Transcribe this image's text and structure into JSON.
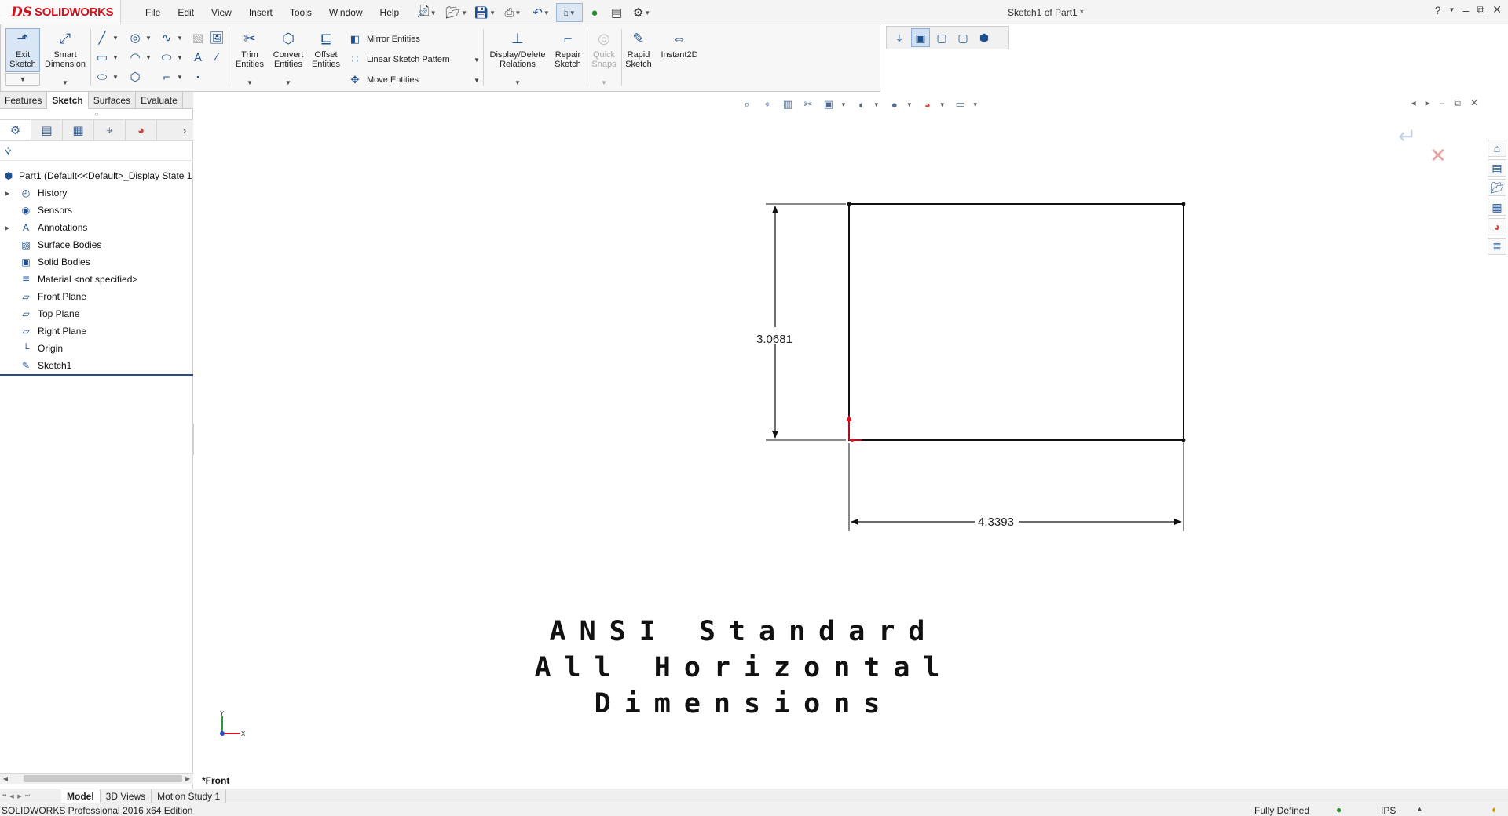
{
  "app": {
    "brand": "SOLIDWORKS",
    "brand_mark": "DS",
    "document_title": "Sketch1 of Part1 *"
  },
  "menu": [
    "File",
    "Edit",
    "View",
    "Insert",
    "Tools",
    "Window",
    "Help"
  ],
  "window_controls": {
    "help": "?",
    "minimize": "–",
    "restore": "⧉",
    "close": "✕"
  },
  "command_manager": {
    "exit_sketch": "Exit Sketch",
    "smart_dimension": "Smart Dimension",
    "trim_entities": "Trim Entities",
    "convert_entities": "Convert Entities",
    "offset_entities": "Offset Entities",
    "mirror_entities": "Mirror Entities",
    "linear_sketch_pattern": "Linear Sketch Pattern",
    "move_entities": "Move Entities",
    "display_delete_relations": "Display/Delete Relations",
    "repair_sketch": "Repair Sketch",
    "quick_snaps": "Quick Snaps",
    "rapid_sketch": "Rapid Sketch",
    "instant2d": "Instant2D"
  },
  "cm_tabs": [
    {
      "label": "Features",
      "active": false
    },
    {
      "label": "Sketch",
      "active": true
    },
    {
      "label": "Surfaces",
      "active": false
    },
    {
      "label": "Evaluate",
      "active": false
    }
  ],
  "feature_tree": {
    "root": "Part1  (Default<<Default>_Display State 1",
    "items": [
      {
        "label": "History",
        "icon": "history-icon",
        "expandable": true
      },
      {
        "label": "Sensors",
        "icon": "sensors-icon",
        "expandable": false
      },
      {
        "label": "Annotations",
        "icon": "annotations-icon",
        "expandable": true
      },
      {
        "label": "Surface Bodies",
        "icon": "surface-bodies-icon",
        "expandable": false
      },
      {
        "label": "Solid Bodies",
        "icon": "solid-bodies-icon",
        "expandable": false
      },
      {
        "label": "Material <not specified>",
        "icon": "material-icon",
        "expandable": false
      },
      {
        "label": "Front Plane",
        "icon": "plane-icon",
        "expandable": false
      },
      {
        "label": "Top Plane",
        "icon": "plane-icon",
        "expandable": false
      },
      {
        "label": "Right Plane",
        "icon": "plane-icon",
        "expandable": false
      },
      {
        "label": "Origin",
        "icon": "origin-icon",
        "expandable": false
      },
      {
        "label": "Sketch1",
        "icon": "sketch-icon",
        "expandable": false
      }
    ]
  },
  "drawing": {
    "vertical_dimension": "3.0681",
    "horizontal_dimension": "4.3393",
    "caption_line1": "ANSI Standard",
    "caption_line2": "All Horizontal Dimensions",
    "view_name": "*Front",
    "triad_y": "Y",
    "triad_x": "X"
  },
  "bottom_tabs": [
    {
      "label": "Model",
      "active": true
    },
    {
      "label": "3D Views",
      "active": false
    },
    {
      "label": "Motion Study 1",
      "active": false
    }
  ],
  "status": {
    "edition": "SOLIDWORKS Professional 2016 x64 Edition",
    "sketch_state": "Fully Defined",
    "units": "IPS"
  }
}
